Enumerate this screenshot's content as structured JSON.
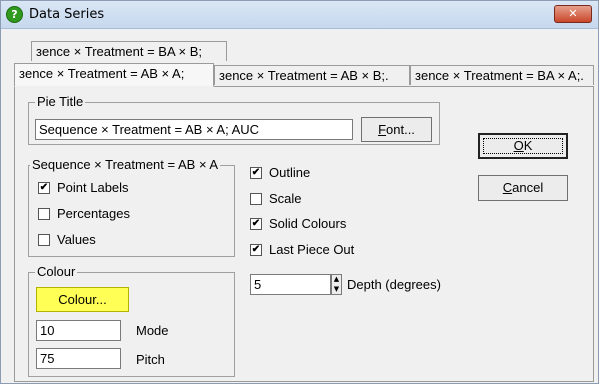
{
  "window": {
    "title": "Data Series",
    "close_icon": "✕"
  },
  "tabs": {
    "row_back": [
      {
        "label": "зence × Treatment = BA × B;"
      }
    ],
    "row_front": [
      {
        "label": "зence × Treatment = AB × A;",
        "active": true
      },
      {
        "label": "зence × Treatment = AB × B;."
      },
      {
        "label": "зence × Treatment = BA × A;."
      }
    ]
  },
  "pie_title": {
    "label": "Pie Title",
    "value": "Sequence × Treatment = AB × A; AUC",
    "font_button": {
      "pre": "",
      "accel": "F",
      "post": "ont..."
    }
  },
  "ok_button": {
    "pre": "",
    "accel": "O",
    "post": "K"
  },
  "cancel_button": {
    "pre": "",
    "accel": "C",
    "post": "ancel"
  },
  "series_group": {
    "label": "Sequence × Treatment = AB × A",
    "options": [
      {
        "label": "Point Labels",
        "checked": true
      },
      {
        "label": "Percentages",
        "checked": false
      },
      {
        "label": "Values",
        "checked": false
      }
    ]
  },
  "general_options": [
    {
      "label": "Outline",
      "checked": true
    },
    {
      "label": "Scale",
      "checked": false
    },
    {
      "label": "Solid Colours",
      "checked": true
    },
    {
      "label": "Last Piece Out",
      "checked": true
    }
  ],
  "depth": {
    "value": "5",
    "label": "Depth (degrees)"
  },
  "colour_group": {
    "label": "Colour",
    "button_label": "Colour...",
    "button_color": "#ffff55",
    "mode_value": "10",
    "mode_label": "Mode",
    "pitch_value": "75",
    "pitch_label": "Pitch"
  },
  "check_mark": "✔",
  "icons": {
    "app": "question-icon",
    "spin_up": "▲",
    "spin_down": "▼"
  }
}
